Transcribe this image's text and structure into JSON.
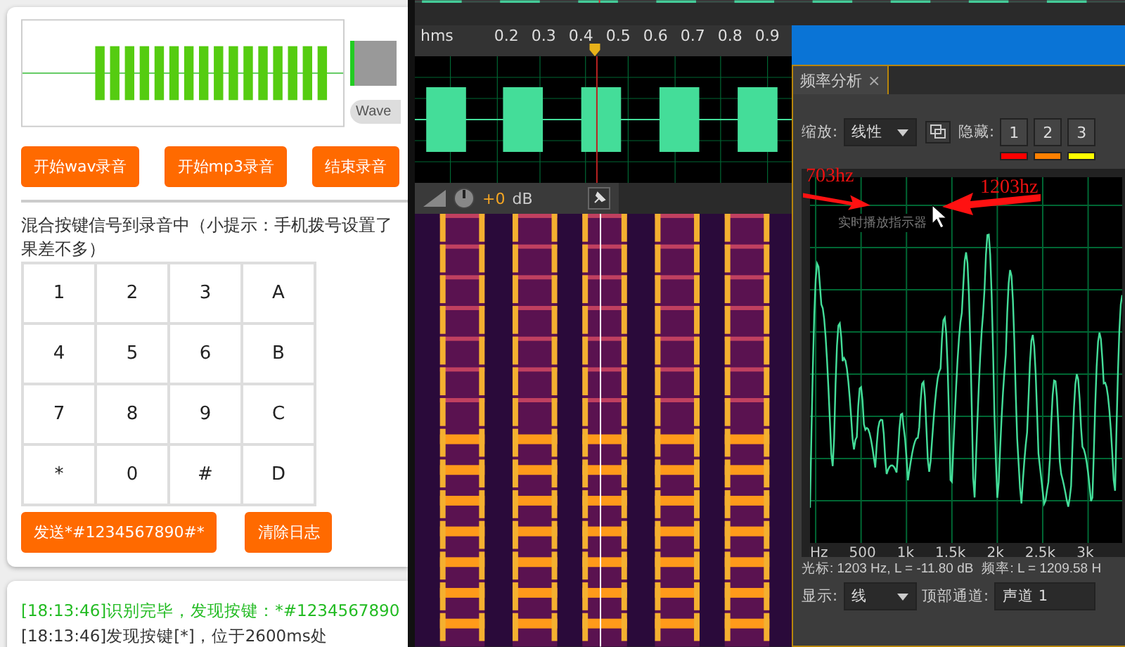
{
  "recorder": {
    "wave_button": "Wave",
    "buttons": [
      "开始wav录音",
      "开始mp3录音",
      "结束录音"
    ]
  },
  "dtmf": {
    "hint_lines": [
      "混合按键信号到录音中（小提示：手机拨号设置了",
      "果差不多）"
    ],
    "keys": [
      [
        "1",
        "2",
        "3",
        "A"
      ],
      [
        "4",
        "5",
        "6",
        "B"
      ],
      [
        "7",
        "8",
        "9",
        "C"
      ],
      [
        "*",
        "0",
        "#",
        "D"
      ]
    ],
    "send_button": "发送*#1234567890#*",
    "clear_button": "清除日志"
  },
  "log": [
    {
      "kind": "result",
      "text": "[18:13:46]识别完毕，发现按键：*#1234567890"
    },
    {
      "kind": "info",
      "text": "[18:13:46]发现按键[*]，位于2600ms处"
    }
  ],
  "editor": {
    "ruler": {
      "unit": "hms",
      "ticks": [
        "0.2",
        "0.3",
        "0.4",
        "0.5",
        "0.6",
        "0.7",
        "0.8",
        "0.9"
      ]
    },
    "gain": {
      "value": "+0",
      "unit": "dB"
    }
  },
  "frequency_panel": {
    "tab": {
      "label": "频率分析",
      "close": "×"
    },
    "zoom": {
      "label": "缩放:",
      "value": "线性"
    },
    "hide": {
      "label": "隐藏:",
      "channels": [
        {
          "label": "1",
          "color": "#ff0000"
        },
        {
          "label": "2",
          "color": "#ff8000"
        },
        {
          "label": "3",
          "color": "#ffff00"
        }
      ]
    },
    "annotations": [
      "703hz",
      "1203hz"
    ],
    "overlay_label": "实时播放指示器",
    "axis": [
      "Hz",
      "500",
      "1k",
      "1.5k",
      "2k",
      "2.5k",
      "3k"
    ],
    "cursor_readout": "光标: 1203 Hz, L = -11.80 dB",
    "frequency_readout": "频率: L = 1209.58 H",
    "display": {
      "label": "显示:",
      "value": "线"
    },
    "top_channel": {
      "label": "顶部通道:",
      "value": "声道 1"
    }
  }
}
